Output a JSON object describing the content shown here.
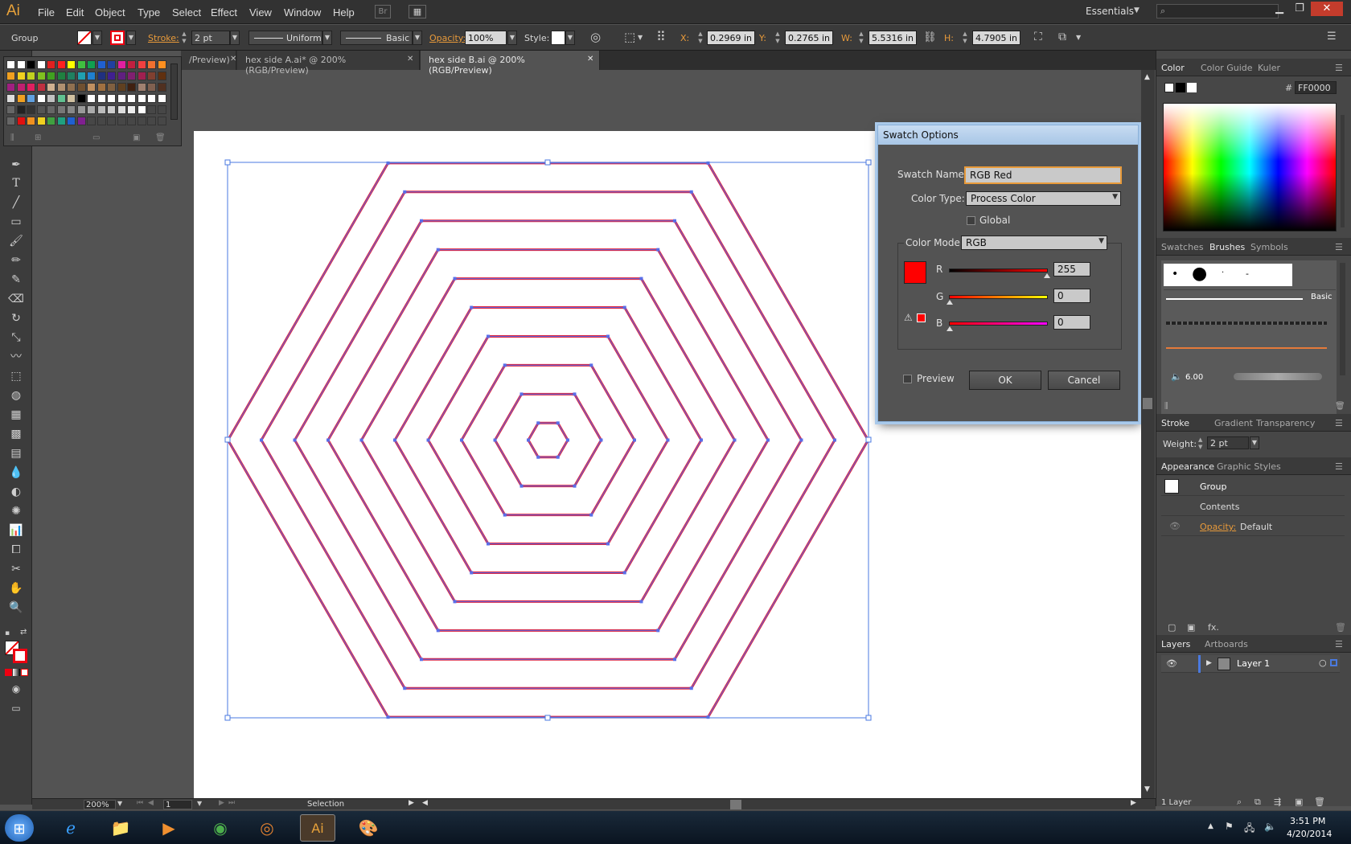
{
  "app": {
    "logo": "Ai",
    "workspace": "Essentials"
  },
  "menu": [
    "File",
    "Edit",
    "Object",
    "Type",
    "Select",
    "Effect",
    "View",
    "Window",
    "Help"
  ],
  "bridge_btn": "Br",
  "controlbar": {
    "selection_type": "Group",
    "stroke_label": "Stroke:",
    "stroke_weight": "2 pt",
    "stroke_profile": "Uniform",
    "brush_def": "Basic",
    "opacity_label": "Opacity:",
    "opacity_value": "100%",
    "style_label": "Style:",
    "x_label": "X:",
    "x_value": "0.2969 in",
    "y_label": "Y:",
    "y_value": "0.2765 in",
    "w_label": "W:",
    "w_value": "5.5316 in",
    "h_label": "H:",
    "h_value": "4.7905 in"
  },
  "tabs": [
    {
      "label": "/Preview)"
    },
    {
      "label": "hex side A.ai* @ 200% (RGB/Preview)"
    },
    {
      "label": "hex side B.ai @ 200% (RGB/Preview)"
    }
  ],
  "dialog": {
    "title": "Swatch Options",
    "swatch_name_label": "Swatch Name:",
    "swatch_name_value": "RGB Red",
    "color_type_label": "Color Type:",
    "color_type_value": "Process Color",
    "global_label": "Global",
    "color_mode_label": "Color Mode:",
    "color_mode_value": "RGB",
    "r_label": "R",
    "r_value": "255",
    "g_label": "G",
    "g_value": "0",
    "b_label": "B",
    "b_value": "0",
    "preview_label": "Preview",
    "ok_label": "OK",
    "cancel_label": "Cancel",
    "swatch_color": "#FF0000"
  },
  "color_panel": {
    "tabs": [
      "Color",
      "Color Guide",
      "Kuler"
    ],
    "hex_label": "#",
    "hex_value": "FF0000"
  },
  "brushes_panel": {
    "tabs": [
      "Swatches",
      "Brushes",
      "Symbols"
    ],
    "basic_label": "Basic",
    "size_label": "6.00"
  },
  "stroke_panel": {
    "tabs": [
      "Stroke",
      "Gradient",
      "Transparency"
    ],
    "weight_label": "Weight:",
    "weight_value": "2 pt"
  },
  "appearance_panel": {
    "tabs": [
      "Appearance",
      "Graphic Styles"
    ],
    "rows": [
      "Group",
      "Contents"
    ],
    "opacity_label": "Opacity:",
    "opacity_value": "Default"
  },
  "layers_panel": {
    "tabs": [
      "Layers",
      "Artboards"
    ],
    "layer_name": "Layer 1",
    "footer": "1 Layer"
  },
  "statusbar": {
    "zoom": "200%",
    "page": "1",
    "mode": "Selection"
  },
  "taskbar": {
    "time": "3:51 PM",
    "date": "4/20/2014"
  }
}
